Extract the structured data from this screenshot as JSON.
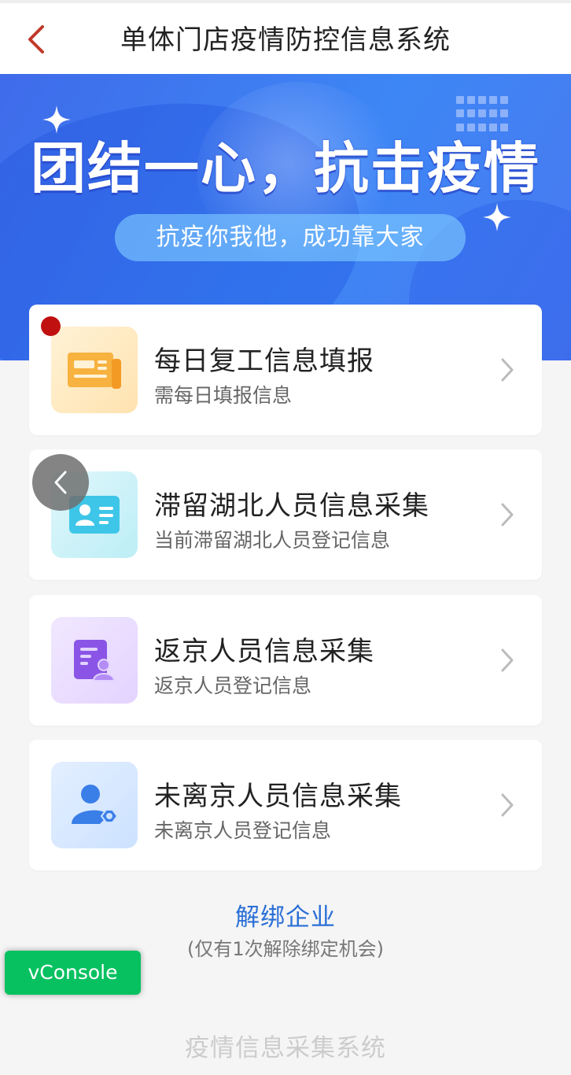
{
  "header": {
    "title": "单体门店疫情防控信息系统",
    "back_icon": "chevron-left-icon",
    "accent_color": "#c0392b"
  },
  "banner": {
    "headline": "团结一心，抗击疫情",
    "subline": "抗疫你我他，成功靠大家"
  },
  "cards": [
    {
      "title": "每日复工信息填报",
      "subtitle": "需每日填报信息",
      "icon": "newspaper-icon",
      "has_badge": true,
      "badge_color": "#c01010"
    },
    {
      "title": "滞留湖北人员信息采集",
      "subtitle": "当前滞留湖北人员登记信息",
      "icon": "id-card-icon",
      "has_badge": false
    },
    {
      "title": "返京人员信息采集",
      "subtitle": "返京人员登记信息",
      "icon": "form-user-icon",
      "has_badge": false
    },
    {
      "title": "未离京人员信息采集",
      "subtitle": "未离京人员登记信息",
      "icon": "user-settings-icon",
      "has_badge": false
    }
  ],
  "unbind": {
    "link_label": "解绑企业",
    "note": "(仅有1次解除绑定机会)"
  },
  "vconsole_label": "vConsole",
  "footer": "疫情信息采集系统"
}
